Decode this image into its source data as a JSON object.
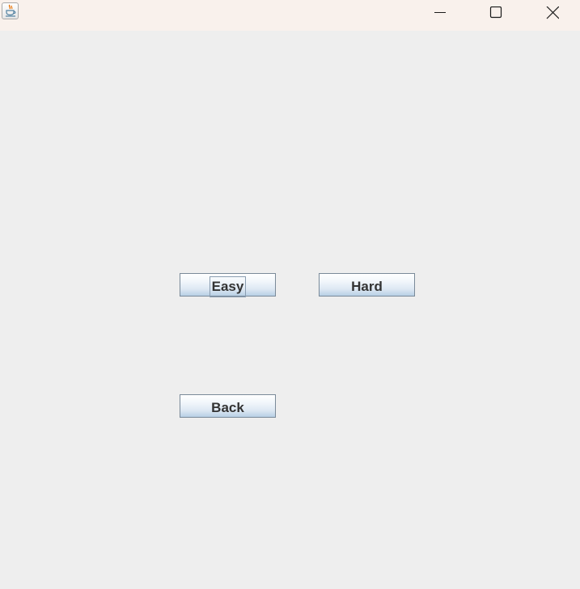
{
  "window": {
    "titlebar": {
      "icon": "java-coffee-cup-icon",
      "controls": {
        "minimize": "minimize-icon",
        "maximize": "maximize-icon",
        "close": "close-icon"
      }
    }
  },
  "menu": {
    "easy_label": "Easy",
    "hard_label": "Hard",
    "back_label": "Back"
  },
  "colors": {
    "titlebar_bg": "#f9f1ec",
    "panel_bg": "#eeeeee",
    "button_text": "#333333",
    "button_border": "#7a8a99"
  }
}
